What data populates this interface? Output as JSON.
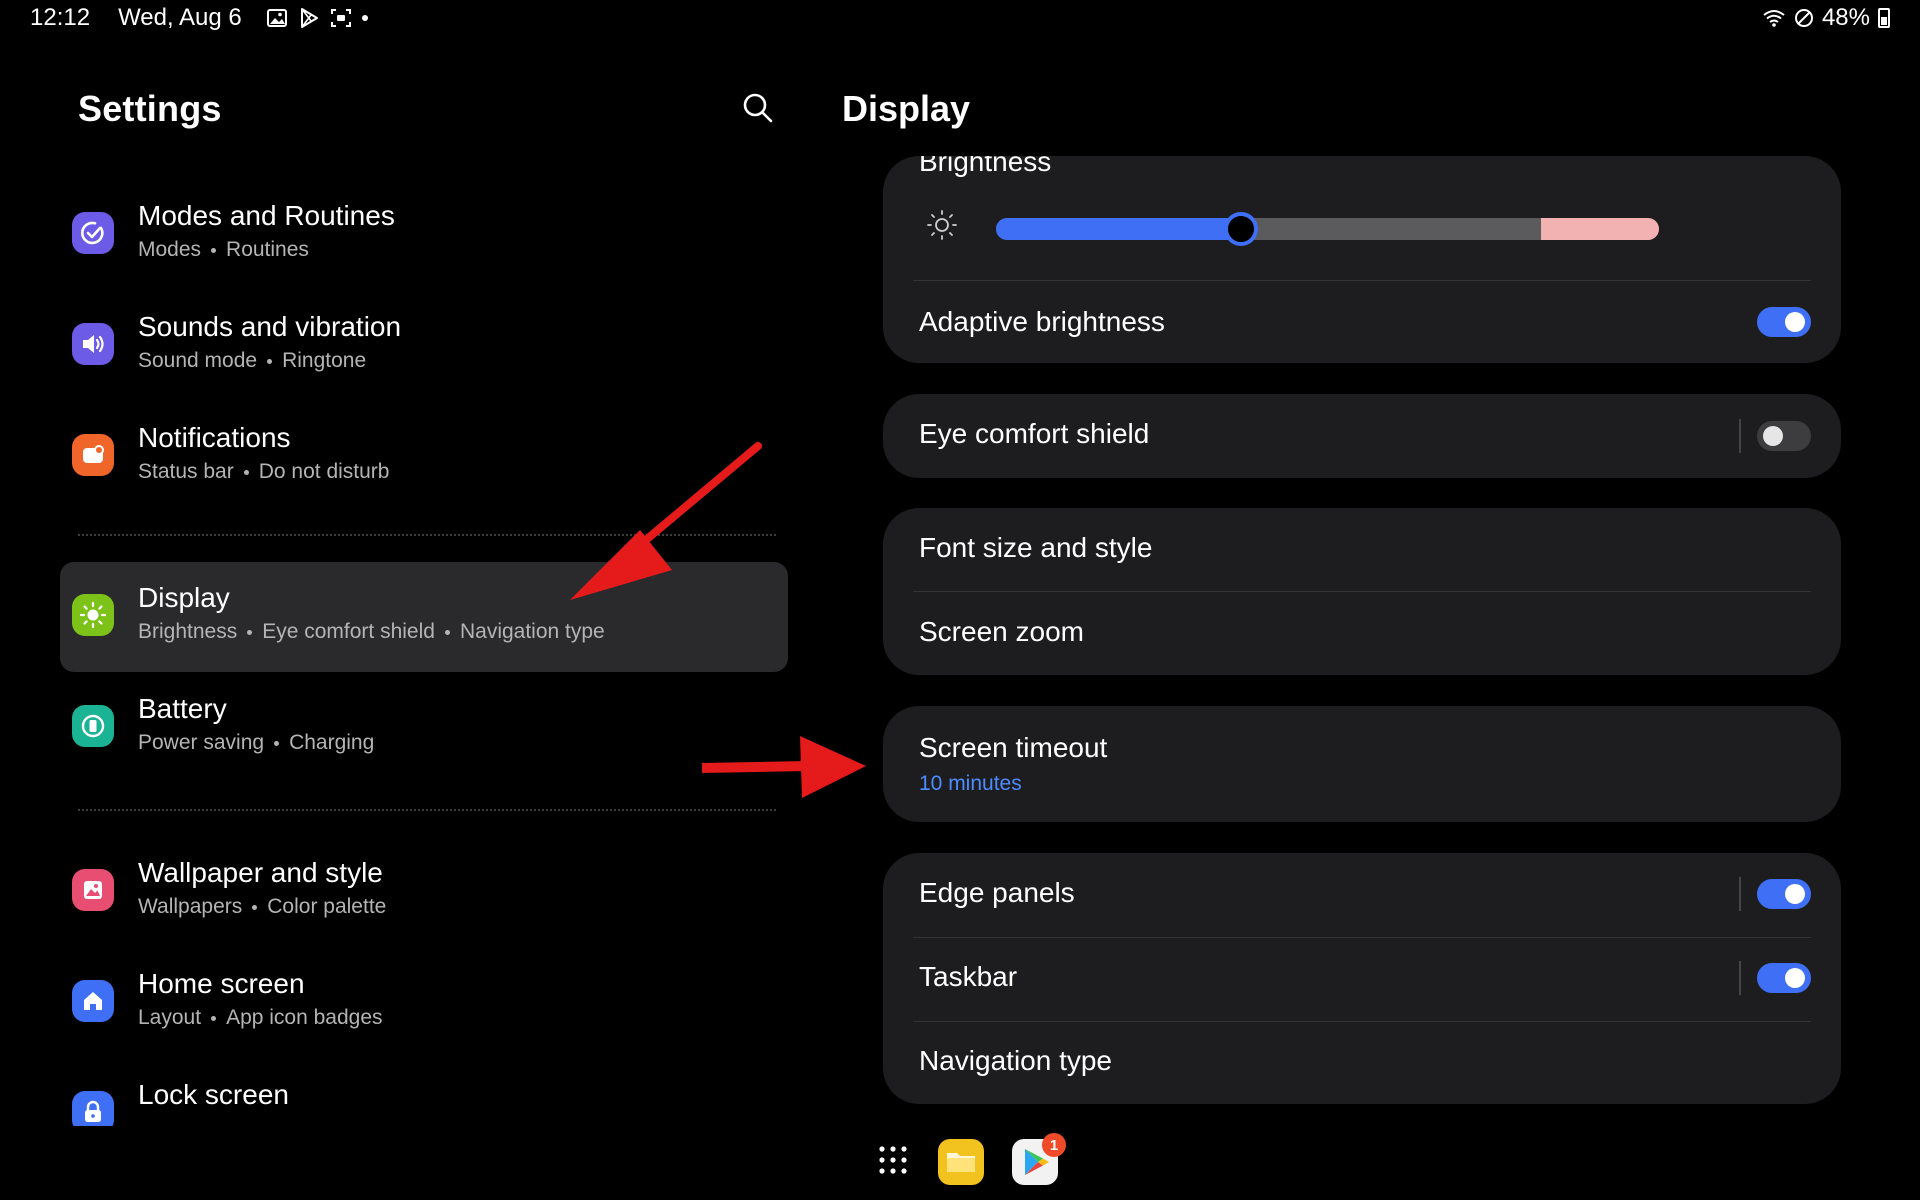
{
  "status_bar": {
    "time": "12:12",
    "date": "Wed, Aug 6",
    "battery": "48%"
  },
  "left_panel": {
    "title": "Settings",
    "items": [
      {
        "title": "Modes and Routines",
        "subtitle": [
          "Modes",
          "Routines"
        ],
        "icon": "modes-icon",
        "color": "#6b5be6"
      },
      {
        "title": "Sounds and vibration",
        "subtitle": [
          "Sound mode",
          "Ringtone"
        ],
        "icon": "speaker-icon",
        "color": "#6b5be6"
      },
      {
        "title": "Notifications",
        "subtitle": [
          "Status bar",
          "Do not disturb"
        ],
        "icon": "notification-icon",
        "color": "#f06529"
      },
      {
        "title": "Display",
        "subtitle": [
          "Brightness",
          "Eye comfort shield",
          "Navigation type"
        ],
        "icon": "sun-icon",
        "color": "#7cc219",
        "selected": true
      },
      {
        "title": "Battery",
        "subtitle": [
          "Power saving",
          "Charging"
        ],
        "icon": "battery-icon",
        "color": "#1ab394"
      },
      {
        "title": "Wallpaper and style",
        "subtitle": [
          "Wallpapers",
          "Color palette"
        ],
        "icon": "wallpaper-icon",
        "color": "#e84d72"
      },
      {
        "title": "Home screen",
        "subtitle": [
          "Layout",
          "App icon badges"
        ],
        "icon": "home-icon",
        "color": "#3e6ff5"
      },
      {
        "title": "Lock screen",
        "subtitle": [],
        "icon": "lock-icon",
        "color": "#3e6ff5"
      }
    ]
  },
  "right_panel": {
    "title": "Display",
    "brightness": {
      "label": "Brightness",
      "level": 0.37
    },
    "adaptive_brightness": {
      "label": "Adaptive brightness",
      "on": true
    },
    "eye_comfort": {
      "label": "Eye comfort shield",
      "on": false
    },
    "font_size": {
      "label": "Font size and style"
    },
    "screen_zoom": {
      "label": "Screen zoom"
    },
    "screen_timeout": {
      "label": "Screen timeout",
      "value": "10 minutes"
    },
    "edge_panels": {
      "label": "Edge panels",
      "on": true
    },
    "taskbar": {
      "label": "Taskbar",
      "on": true
    },
    "navigation_type": {
      "label": "Navigation type"
    }
  },
  "taskbar": {
    "play_badge": "1"
  },
  "colors": {
    "accent": "#3e6ff5",
    "link": "#4d8bff",
    "annotation_arrow": "#e51b1b"
  }
}
